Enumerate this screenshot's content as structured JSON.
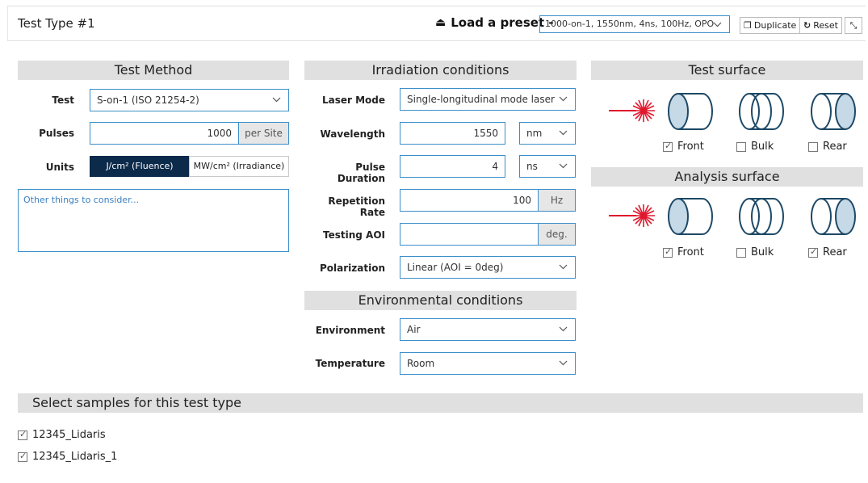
{
  "header": {
    "title": "Test Type #1",
    "preset_label": "Load a preset -",
    "preset_value": "1000-on-1, 1550nm, 4ns, 100Hz, OPO",
    "duplicate_label": "Duplicate",
    "reset_label": "Reset"
  },
  "test_method": {
    "heading": "Test Method",
    "test_label": "Test",
    "test_value": "S-on-1 (ISO 21254-2)",
    "pulses_label": "Pulses",
    "pulses_value": "1000",
    "pulses_unit": "per Site",
    "units_label": "Units",
    "units_options": [
      "J/cm² (Fluence)",
      "MW/cm² (Irradiance)"
    ],
    "units_selected": "J/cm² (Fluence)",
    "notes_placeholder": "Other things to consider..."
  },
  "irradiation": {
    "heading": "Irradiation conditions",
    "laser_mode_label": "Laser Mode",
    "laser_mode_value": "Single-longitudinal mode laser",
    "wavelength_label": "Wavelength",
    "wavelength_value": "1550",
    "wavelength_unit": "nm",
    "pulse_duration_label": "Pulse Duration",
    "pulse_duration_value": "4",
    "pulse_duration_unit": "ns",
    "rep_rate_label": "Repetition Rate",
    "rep_rate_value": "100",
    "rep_rate_unit": "Hz",
    "aoi_label": "Testing AOI",
    "aoi_value": "",
    "aoi_unit": "deg.",
    "polarization_label": "Polarization",
    "polarization_value": "Linear (AOI = 0deg)"
  },
  "environmental": {
    "heading": "Environmental conditions",
    "environment_label": "Environment",
    "environment_value": "Air",
    "temperature_label": "Temperature",
    "temperature_value": "Room"
  },
  "test_surface": {
    "heading": "Test surface",
    "options": [
      {
        "label": "Front",
        "checked": true
      },
      {
        "label": "Bulk",
        "checked": false
      },
      {
        "label": "Rear",
        "checked": false
      }
    ]
  },
  "analysis_surface": {
    "heading": "Analysis surface",
    "options": [
      {
        "label": "Front",
        "checked": true
      },
      {
        "label": "Bulk",
        "checked": false
      },
      {
        "label": "Rear",
        "checked": true
      }
    ]
  },
  "samples": {
    "heading": "Select samples for this test type",
    "items": [
      {
        "label": "12345_Lidaris",
        "checked": true
      },
      {
        "label": "12345_Lidaris_1",
        "checked": true
      }
    ]
  },
  "colors": {
    "accent": "#3b8fc9",
    "active_segment": "#0c2a4a",
    "laser": "#e0182d",
    "optic_stroke": "#1d4966",
    "optic_fill": "#c5d9e6"
  }
}
